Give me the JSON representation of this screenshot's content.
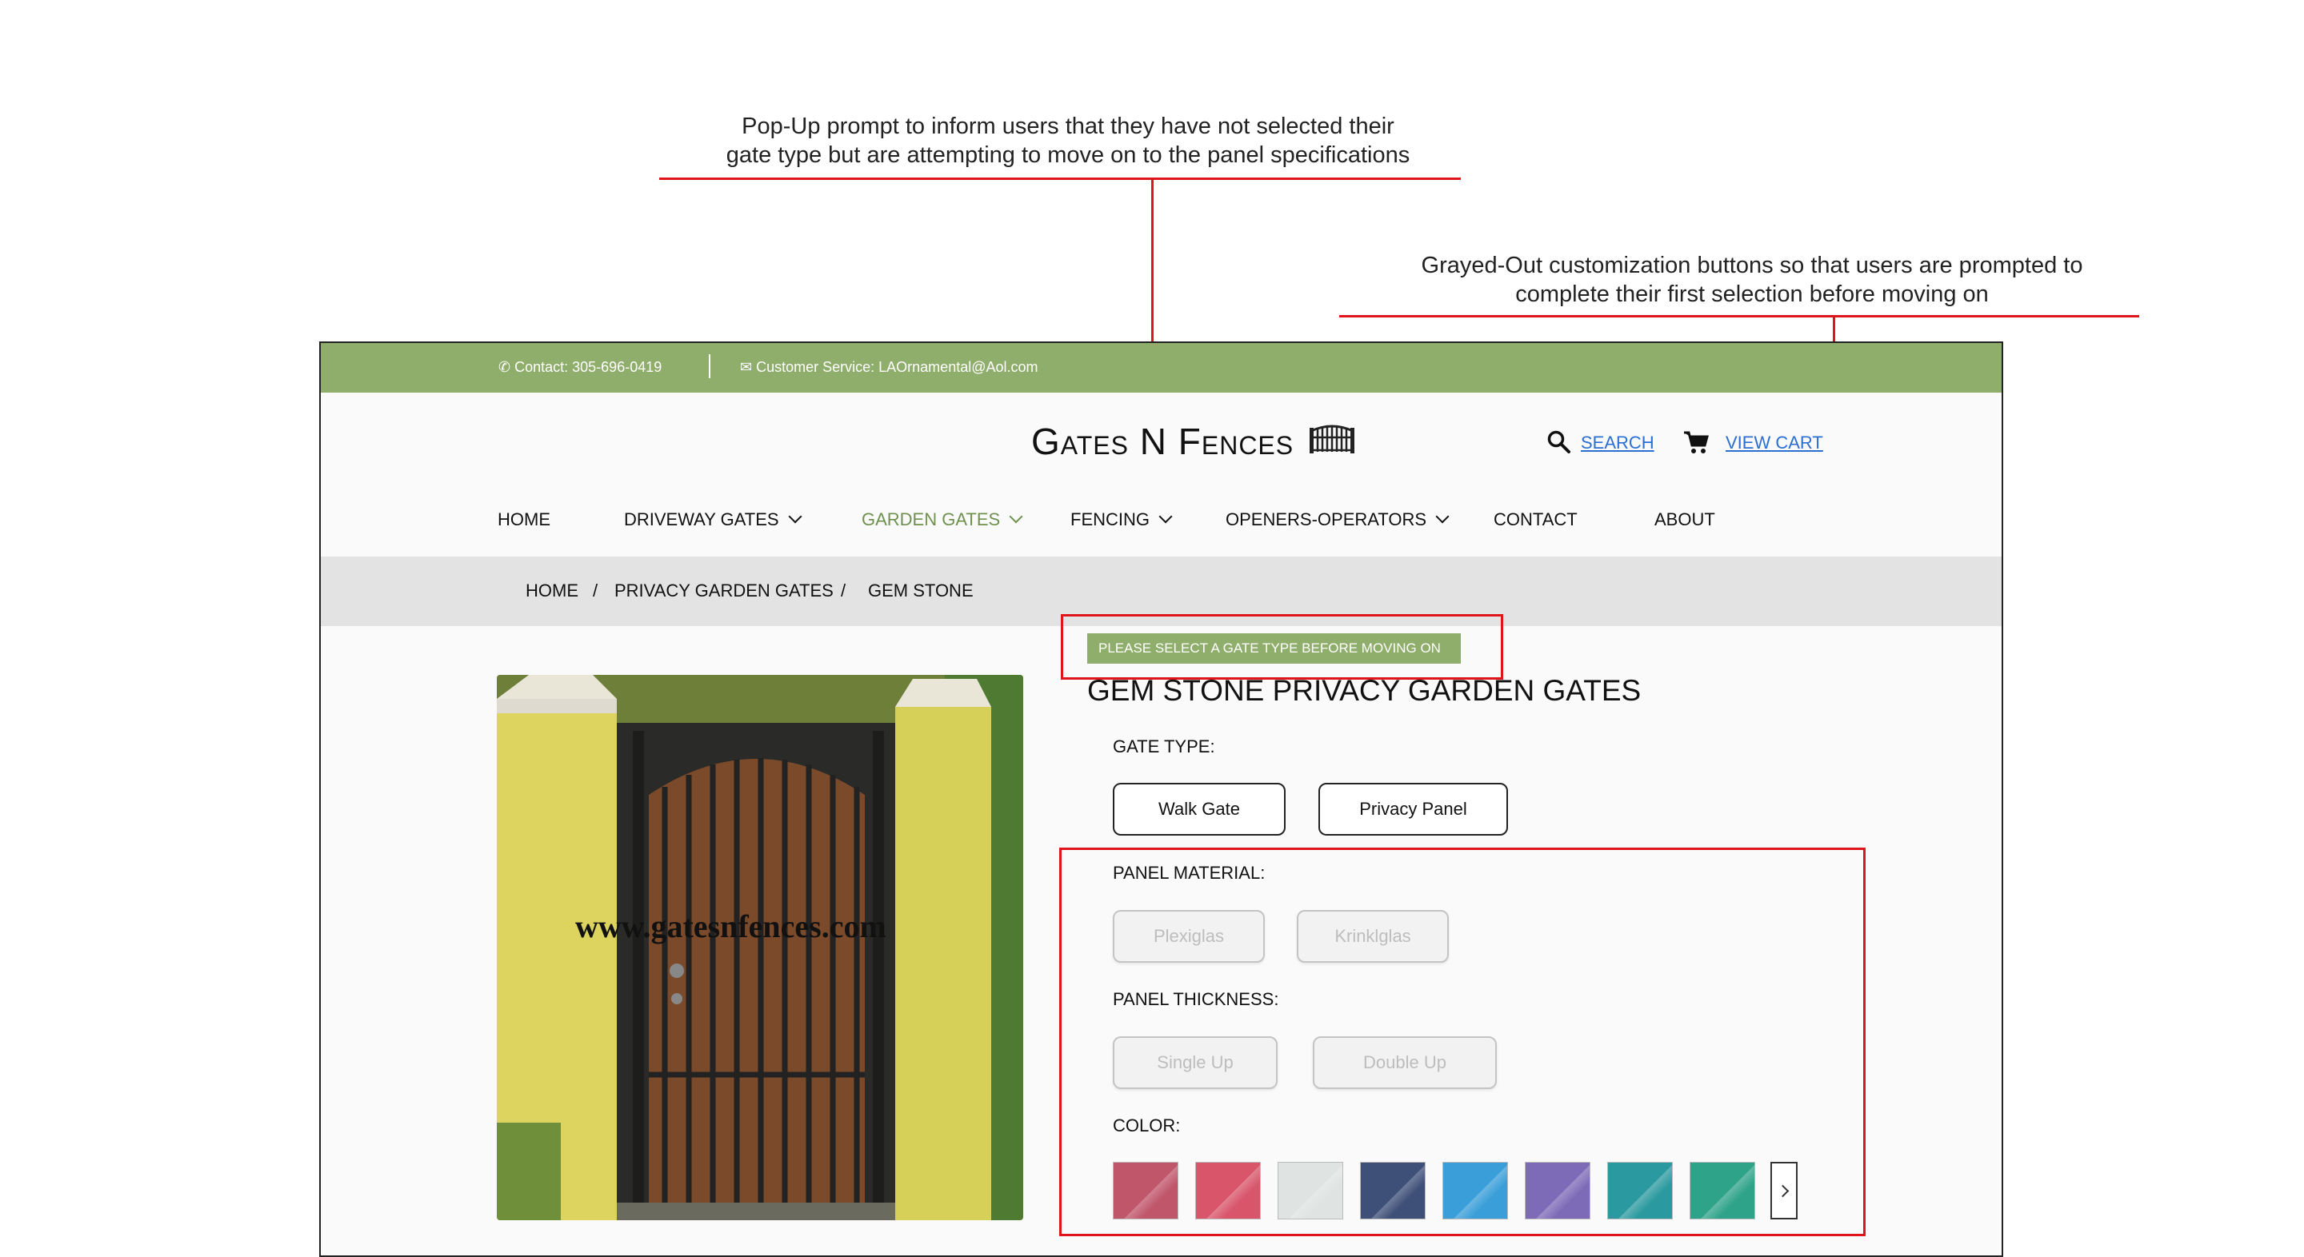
{
  "annotations": {
    "popup_note": [
      "Pop-Up prompt to inform users that they have not selected their",
      "gate type but are attempting to move on to the panel specifications"
    ],
    "grayed_note": [
      "Grayed-Out customization buttons so that users are prompted to",
      "complete their first selection before moving on"
    ],
    "accent_color": "#e0141b"
  },
  "topbar": {
    "contact": "Contact: 305-696-0419",
    "email": "Customer Service: LAOrnamental@Aol.com",
    "color": "#8fad6b"
  },
  "header": {
    "logo": "Gates N Fences",
    "search_label": "SEARCH",
    "cart_label": "VIEW CART"
  },
  "nav": {
    "items": [
      "HOME",
      "DRIVEWAY GATES",
      "GARDEN GATES",
      "FENCING",
      "OPENERS-OPERATORS",
      "CONTACT",
      "ABOUT"
    ],
    "active": "GARDEN GATES",
    "active_color": "#6f9150"
  },
  "breadcrumb": [
    "HOME",
    "PRIVACY GARDEN GATES",
    "GEM STONE"
  ],
  "popup": {
    "message": "PLEASE SELECT A GATE TYPE BEFORE MOVING ON"
  },
  "product": {
    "image_watermark": "www.gatesnfences.com",
    "title": "GEM STONE PRIVACY GARDEN GATES",
    "gate_type": {
      "label": "GATE TYPE:",
      "options": [
        "Walk Gate",
        "Privacy Panel"
      ]
    },
    "panel_material": {
      "label": "PANEL MATERIAL:",
      "options": [
        "Plexiglas",
        "Krinklglas"
      ],
      "state": "disabled"
    },
    "panel_thickness": {
      "label": "PANEL THICKNESS:",
      "options": [
        "Single Up",
        "Double Up"
      ],
      "state": "disabled"
    },
    "color": {
      "label": "COLOR:",
      "swatches": [
        "#c0566a",
        "#d8556a",
        "#dfe3e2",
        "#3e4f78",
        "#3a9ed8",
        "#7e6bb8",
        "#2b9aa0",
        "#2fa38a"
      ]
    }
  }
}
